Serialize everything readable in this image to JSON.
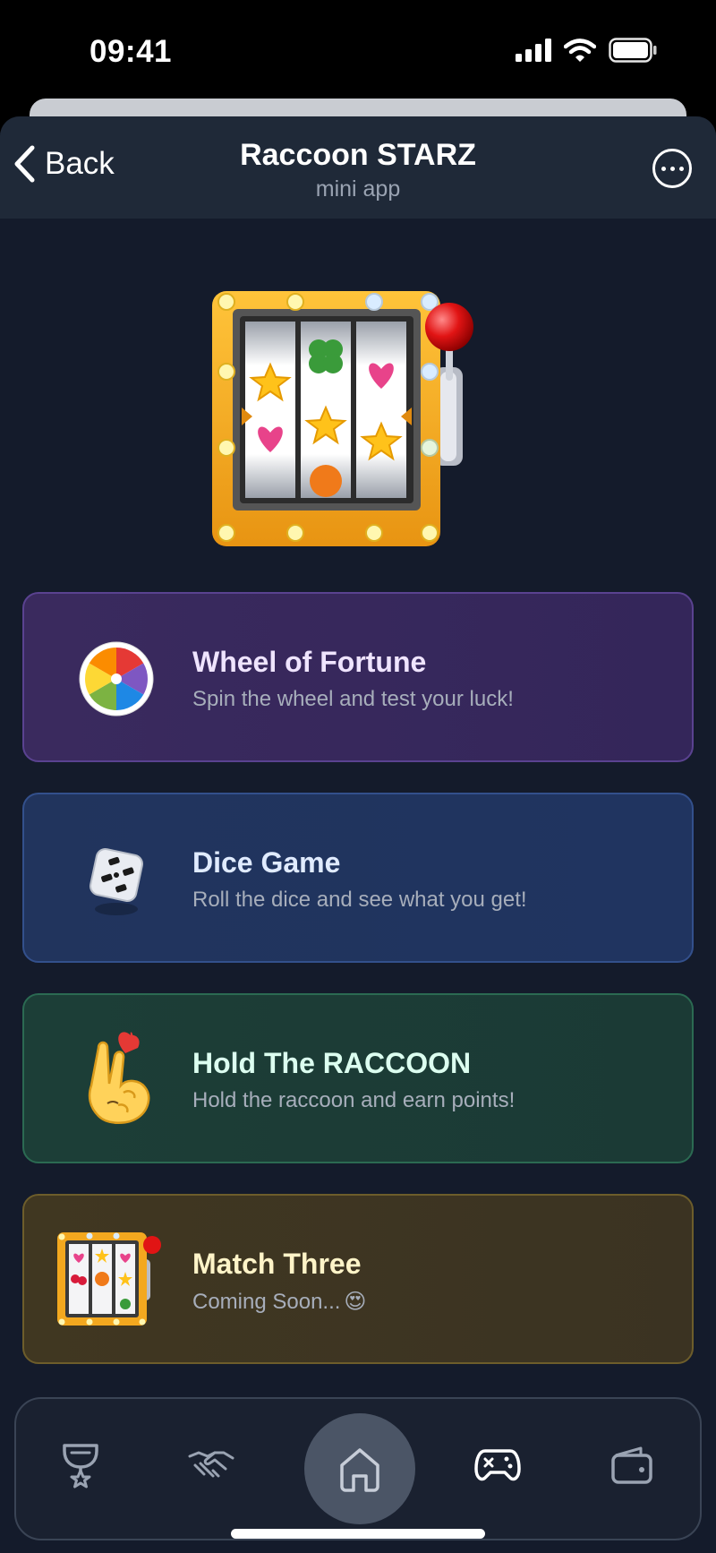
{
  "status_bar": {
    "time": "09:41"
  },
  "header": {
    "back_label": "Back",
    "title": "Raccoon STARZ",
    "subtitle": "mini app"
  },
  "games": [
    {
      "title": "Wheel of Fortune",
      "subtitle": "Spin the wheel and test your luck!",
      "icon": "wheel-icon",
      "accent": "#5a4290"
    },
    {
      "title": "Dice Game",
      "subtitle": "Roll the dice and see what you get!",
      "icon": "dice-icon",
      "accent": "#33508c"
    },
    {
      "title": "Hold The RACCOON",
      "subtitle": "Hold the raccoon and earn points!",
      "icon": "hand-heart-icon",
      "accent": "#2b6a52"
    },
    {
      "title": "Match Three",
      "subtitle": "Coming Soon...",
      "subtitle_emoji": "😍",
      "icon": "slot-machine-icon",
      "accent": "#6d5d2b"
    }
  ],
  "tabbar": {
    "items": [
      "trophy-icon",
      "handshake-icon",
      "home-icon",
      "gamepad-icon",
      "wallet-icon"
    ],
    "active": "home-icon"
  },
  "colors": {
    "background": "#141b2b",
    "header": "#1f2938",
    "active_tab": "#4b5566"
  }
}
